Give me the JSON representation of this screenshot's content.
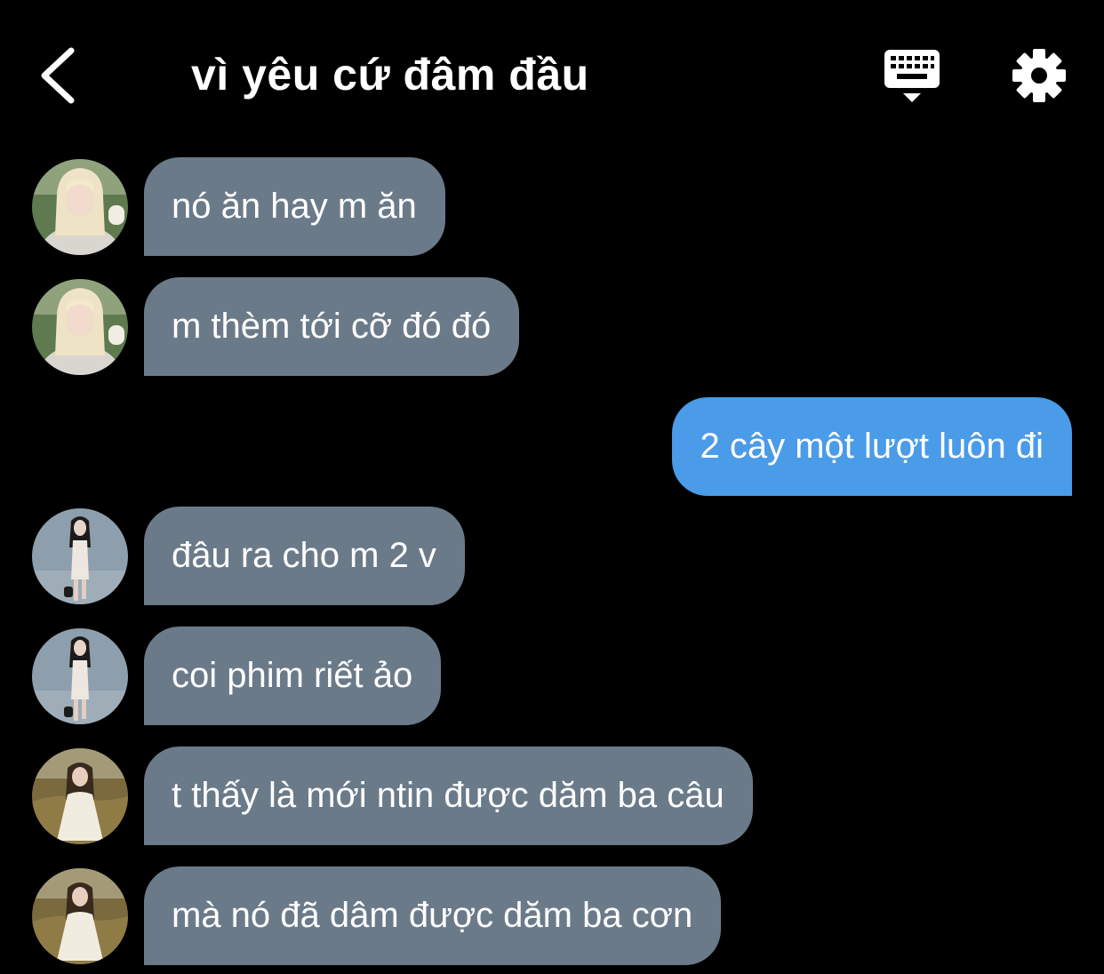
{
  "header": {
    "title": "vì yêu cứ đâm đầu",
    "back_icon": "chevron-left-icon",
    "keyboard_icon": "keyboard-icon",
    "settings_icon": "gear-icon"
  },
  "colors": {
    "background": "#000000",
    "received_bubble": "#6b7a89",
    "sent_bubble": "#4a9be8",
    "text": "#ffffff"
  },
  "messages": [
    {
      "sender": "received",
      "avatar": "avatar-blonde",
      "text": "nó ăn hay m ăn"
    },
    {
      "sender": "received",
      "avatar": "avatar-blonde",
      "text": "m thèm tới cỡ đó đó"
    },
    {
      "sender": "sent",
      "text": "2 cây một lượt luôn đi"
    },
    {
      "sender": "received",
      "avatar": "avatar-dark-hair",
      "text": "đâu ra cho m 2 v"
    },
    {
      "sender": "received",
      "avatar": "avatar-dark-hair",
      "text": "coi phim riết ảo"
    },
    {
      "sender": "received",
      "avatar": "avatar-field",
      "text": "t thấy là mới ntin được dăm ba câu"
    },
    {
      "sender": "received",
      "avatar": "avatar-field",
      "text": "mà nó đã dâm được dăm ba cơn"
    }
  ]
}
